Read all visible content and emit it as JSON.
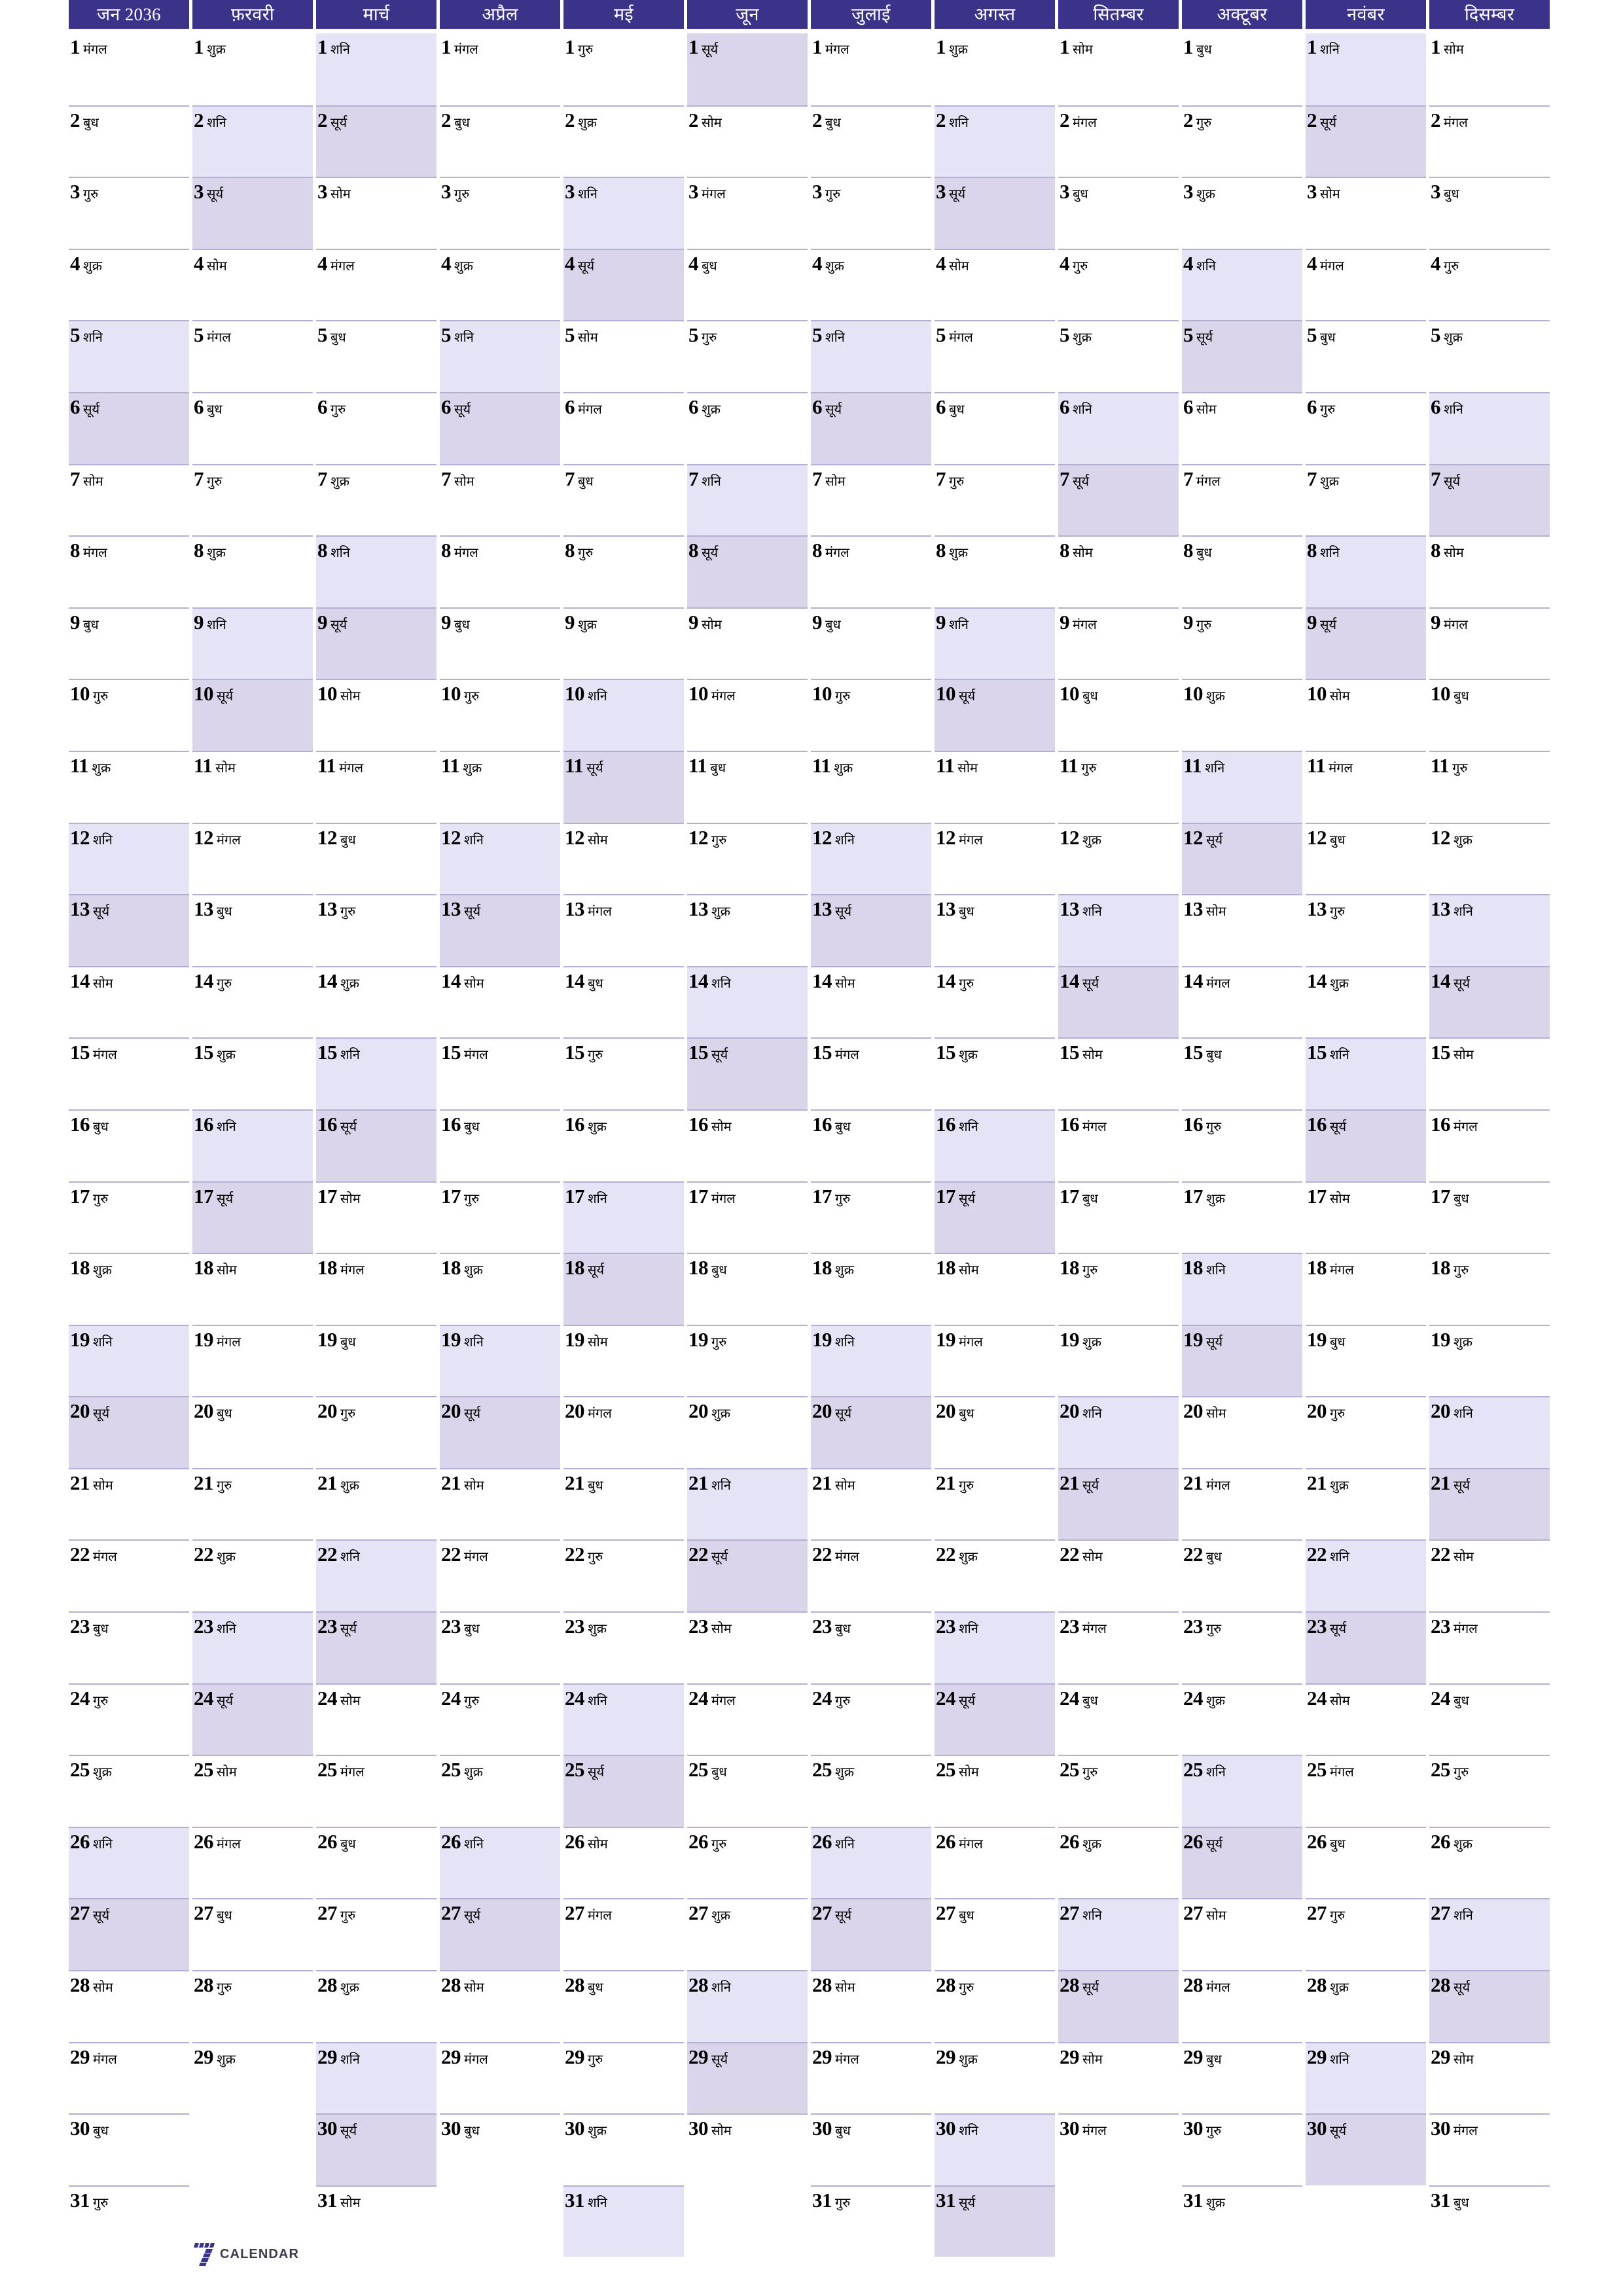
{
  "document": {
    "kind": "yearly-planner-calendar",
    "year": "2036",
    "language": "hi"
  },
  "colors": {
    "header_background": "#3b3389",
    "header_text": "#ffffff",
    "saturday_background": "#e5e4f6",
    "sunday_background": "#dad5eb",
    "cell_divider": "#b3b0d4",
    "day_text": "#000000",
    "logo_mark": "#3b3389",
    "logo_word": "#3c3c46"
  },
  "weekday_names": {
    "sun": "सूर्य",
    "mon": "सोम",
    "tue": "मंगल",
    "wed": "बुध",
    "thu": "गुरु",
    "fri": "शुक्र",
    "sat": "शनि"
  },
  "footer": {
    "logo_mark": "seven-logo-icon",
    "logo_text": "CALENDAR"
  },
  "months": [
    {
      "label": "जन 2036",
      "days": 31,
      "first_weekday": 2,
      "day_names": [
        "मंगल",
        "बुध",
        "गुरु",
        "शुक्र",
        "शनि",
        "सूर्य",
        "सोम",
        "मंगल",
        "बुध",
        "गुरु",
        "शुक्र",
        "शनि",
        "सूर्य",
        "सोम",
        "मंगल",
        "बुध",
        "गुरु",
        "शुक्र",
        "शनि",
        "सूर्य",
        "सोम",
        "मंगल",
        "बुध",
        "गुरु",
        "शुक्र",
        "शनि",
        "सूर्य",
        "सोम",
        "मंगल",
        "बुध",
        "गुरु"
      ]
    },
    {
      "label": "फ़रवरी",
      "days": 29,
      "first_weekday": 5,
      "day_names": [
        "शुक्र",
        "शनि",
        "सूर्य",
        "सोम",
        "मंगल",
        "बुध",
        "गुरु",
        "शुक्र",
        "शनि",
        "सूर्य",
        "सोम",
        "मंगल",
        "बुध",
        "गुरु",
        "शुक्र",
        "शनि",
        "सूर्य",
        "सोम",
        "मंगल",
        "बुध",
        "गुरु",
        "शुक्र",
        "शनि",
        "सूर्य",
        "सोम",
        "मंगल",
        "बुध",
        "गुरु",
        "शुक्र"
      ]
    },
    {
      "label": "मार्च",
      "days": 31,
      "first_weekday": 6,
      "day_names": [
        "शनि",
        "सूर्य",
        "सोम",
        "मंगल",
        "बुध",
        "गुरु",
        "शुक्र",
        "शनि",
        "सूर्य",
        "सोम",
        "मंगल",
        "बुध",
        "गुरु",
        "शुक्र",
        "शनि",
        "सूर्य",
        "सोम",
        "मंगल",
        "बुध",
        "गुरु",
        "शुक्र",
        "शनि",
        "सूर्य",
        "सोम",
        "मंगल",
        "बुध",
        "गुरु",
        "शुक्र",
        "शनि",
        "सूर्य",
        "सोम"
      ]
    },
    {
      "label": "अप्रैल",
      "days": 30,
      "first_weekday": 2,
      "day_names": [
        "मंगल",
        "बुध",
        "गुरु",
        "शुक्र",
        "शनि",
        "सूर्य",
        "सोम",
        "मंगल",
        "बुध",
        "गुरु",
        "शुक्र",
        "शनि",
        "सूर्य",
        "सोम",
        "मंगल",
        "बुध",
        "गुरु",
        "शुक्र",
        "शनि",
        "सूर्य",
        "सोम",
        "मंगल",
        "बुध",
        "गुरु",
        "शुक्र",
        "शनि",
        "सूर्य",
        "सोम",
        "मंगल",
        "बुध"
      ]
    },
    {
      "label": "मई",
      "days": 31,
      "first_weekday": 4,
      "day_names": [
        "गुरु",
        "शुक्र",
        "शनि",
        "सूर्य",
        "सोम",
        "मंगल",
        "बुध",
        "गुरु",
        "शुक्र",
        "शनि",
        "सूर्य",
        "सोम",
        "मंगल",
        "बुध",
        "गुरु",
        "शुक्र",
        "शनि",
        "सूर्य",
        "सोम",
        "मंगल",
        "बुध",
        "गुरु",
        "शुक्र",
        "शनि",
        "सूर्य",
        "सोम",
        "मंगल",
        "बुध",
        "गुरु",
        "शुक्र",
        "शनि"
      ]
    },
    {
      "label": "जून",
      "days": 30,
      "first_weekday": 0,
      "day_names": [
        "सूर्य",
        "सोम",
        "मंगल",
        "बुध",
        "गुरु",
        "शुक्र",
        "शनि",
        "सूर्य",
        "सोम",
        "मंगल",
        "बुध",
        "गुरु",
        "शुक्र",
        "शनि",
        "सूर्य",
        "सोम",
        "मंगल",
        "बुध",
        "गुरु",
        "शुक्र",
        "शनि",
        "सूर्य",
        "सोम",
        "मंगल",
        "बुध",
        "गुरु",
        "शुक्र",
        "शनि",
        "सूर्य",
        "सोम"
      ]
    },
    {
      "label": "जुलाई",
      "days": 31,
      "first_weekday": 2,
      "day_names": [
        "मंगल",
        "बुध",
        "गुरु",
        "शुक्र",
        "शनि",
        "सूर्य",
        "सोम",
        "मंगल",
        "बुध",
        "गुरु",
        "शुक्र",
        "शनि",
        "सूर्य",
        "सोम",
        "मंगल",
        "बुध",
        "गुरु",
        "शुक्र",
        "शनि",
        "सूर्य",
        "सोम",
        "मंगल",
        "बुध",
        "गुरु",
        "शुक्र",
        "शनि",
        "सूर्य",
        "सोम",
        "मंगल",
        "बुध",
        "गुरु"
      ]
    },
    {
      "label": "अगस्त",
      "days": 31,
      "first_weekday": 5,
      "day_names": [
        "शुक्र",
        "शनि",
        "सूर्य",
        "सोम",
        "मंगल",
        "बुध",
        "गुरु",
        "शुक्र",
        "शनि",
        "सूर्य",
        "सोम",
        "मंगल",
        "बुध",
        "गुरु",
        "शुक्र",
        "शनि",
        "सूर्य",
        "सोम",
        "मंगल",
        "बुध",
        "गुरु",
        "शुक्र",
        "शनि",
        "सूर्य",
        "सोम",
        "मंगल",
        "बुध",
        "गुरु",
        "शुक्र",
        "शनि",
        "सूर्य"
      ]
    },
    {
      "label": "सितम्बर",
      "days": 30,
      "first_weekday": 1,
      "day_names": [
        "सोम",
        "मंगल",
        "बुध",
        "गुरु",
        "शुक्र",
        "शनि",
        "सूर्य",
        "सोम",
        "मंगल",
        "बुध",
        "गुरु",
        "शुक्र",
        "शनि",
        "सूर्य",
        "सोम",
        "मंगल",
        "बुध",
        "गुरु",
        "शुक्र",
        "शनि",
        "सूर्य",
        "सोम",
        "मंगल",
        "बुध",
        "गुरु",
        "शुक्र",
        "शनि",
        "सूर्य",
        "सोम",
        "मंगल"
      ]
    },
    {
      "label": "अक्टूबर",
      "days": 31,
      "first_weekday": 3,
      "day_names": [
        "बुध",
        "गुरु",
        "शुक्र",
        "शनि",
        "सूर्य",
        "सोम",
        "मंगल",
        "बुध",
        "गुरु",
        "शुक्र",
        "शनि",
        "सूर्य",
        "सोम",
        "मंगल",
        "बुध",
        "गुरु",
        "शुक्र",
        "शनि",
        "सूर्य",
        "सोम",
        "मंगल",
        "बुध",
        "गुरु",
        "शुक्र",
        "शनि",
        "सूर्य",
        "सोम",
        "मंगल",
        "बुध",
        "गुरु",
        "शुक्र"
      ]
    },
    {
      "label": "नवंबर",
      "days": 30,
      "first_weekday": 6,
      "day_names": [
        "शनि",
        "सूर्य",
        "सोम",
        "मंगल",
        "बुध",
        "गुरु",
        "शुक्र",
        "शनि",
        "सूर्य",
        "सोम",
        "मंगल",
        "बुध",
        "गुरु",
        "शुक्र",
        "शनि",
        "सूर्य",
        "सोम",
        "मंगल",
        "बुध",
        "गुरु",
        "शुक्र",
        "शनि",
        "सूर्य",
        "सोम",
        "मंगल",
        "बुध",
        "गुरु",
        "शुक्र",
        "शनि",
        "सूर्य"
      ]
    },
    {
      "label": "दिसम्बर",
      "days": 31,
      "first_weekday": 1,
      "day_names": [
        "सोम",
        "मंगल",
        "बुध",
        "गुरु",
        "शुक्र",
        "शनि",
        "सूर्य",
        "सोम",
        "मंगल",
        "बुध",
        "गुरु",
        "शुक्र",
        "शनि",
        "सूर्य",
        "सोम",
        "मंगल",
        "बुध",
        "गुरु",
        "शुक्र",
        "शनि",
        "सूर्य",
        "सोम",
        "मंगल",
        "बुध",
        "गुरु",
        "शुक्र",
        "शनि",
        "सूर्य",
        "सोम",
        "मंगल",
        "बुध"
      ]
    }
  ]
}
